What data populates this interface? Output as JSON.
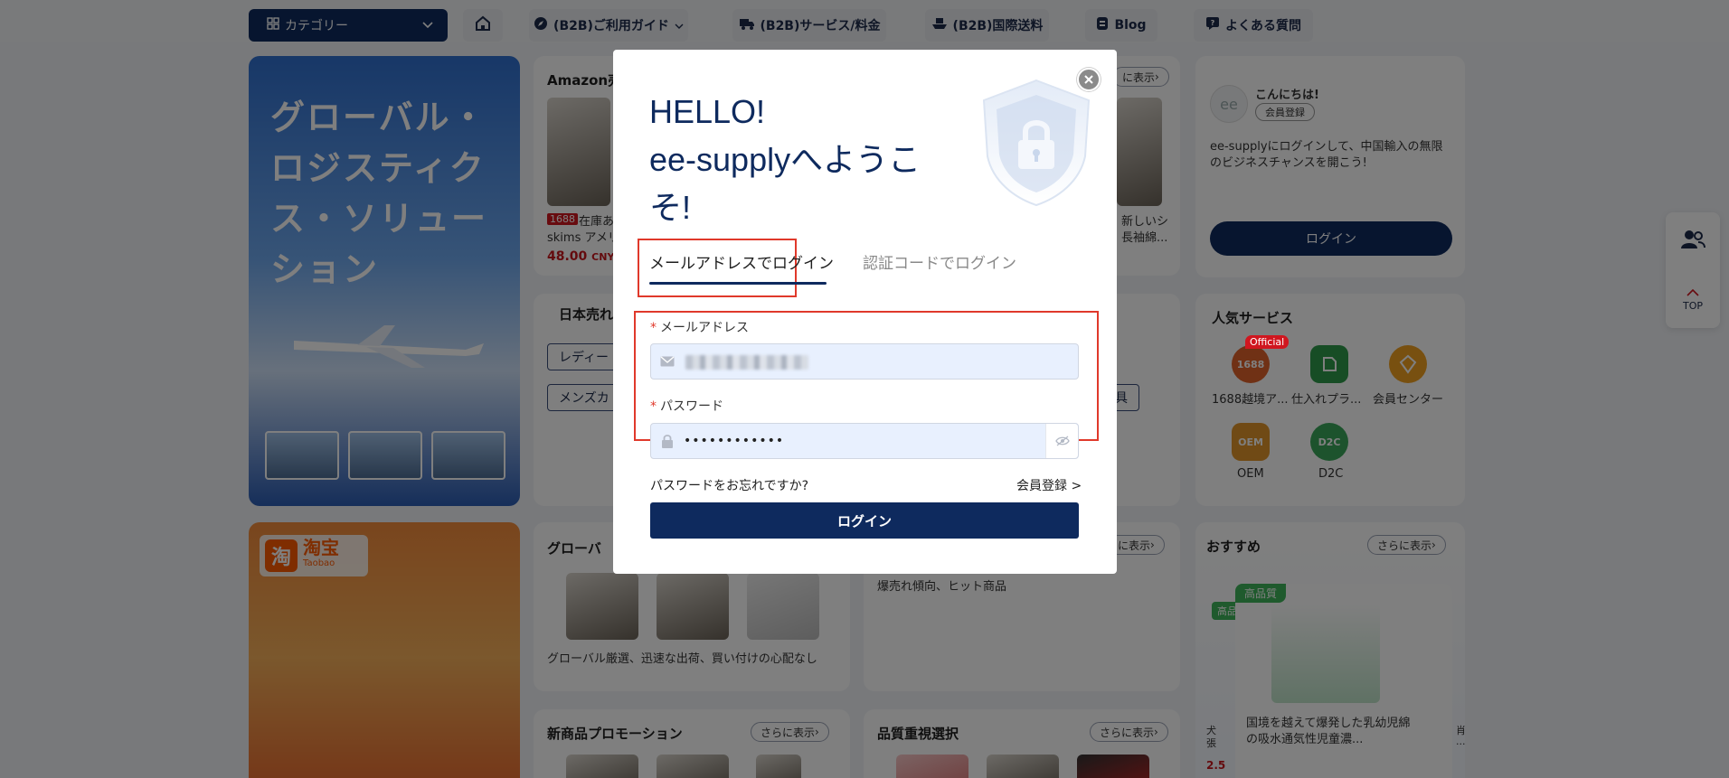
{
  "nav": {
    "category": "カテゴリー",
    "guide": "(B2B)ご利用ガイド",
    "service": "(B2B)サービス/料金",
    "shipping": "(B2B)国際送料",
    "blog": "Blog",
    "faq": "よくある質問"
  },
  "banner_logistics": {
    "title": "グローバル・ロジスティクス・ソリューション"
  },
  "banner_taobao": {
    "icon_char": "淘",
    "name": "淘宝",
    "sub": "Taobao"
  },
  "amazon_section": {
    "title": "Amazon売",
    "more": "に表示",
    "product1": {
      "tag": "1688",
      "name": "在庫あ",
      "line2": "skims アメリ",
      "price": "48.00",
      "currency": "CNY"
    },
    "product2": {
      "name": "新しいシ",
      "line2": "長袖綿..."
    }
  },
  "japan_section": {
    "title": "日本売れ",
    "chip1": "レディー",
    "chip2": "メンズカ",
    "chip3": "具"
  },
  "global_section": {
    "title": "グローバ",
    "more": "に表示",
    "desc": "グローバル厳選、迅速な出荷、買い付けの心配なし"
  },
  "trend_section": {
    "desc": "爆売れ傾向、ヒット商品"
  },
  "new_promo": {
    "title": "新商品プロモーション",
    "more": "さらに表示"
  },
  "quality_select": {
    "title": "品質重視選択",
    "more": "さらに表示"
  },
  "welcome_card": {
    "greeting": "こんにちは!",
    "member_badge": "会員登録",
    "message": "ee-supplyにログインして、中国輸入の無限のビジネスチャンスを開こう!",
    "login": "ログイン"
  },
  "popular_services": {
    "title": "人気サービス",
    "official": "Official",
    "items": [
      {
        "label": "1688越境ア...",
        "icon_text": "1688",
        "color": "#e0622a"
      },
      {
        "label": "仕入れプラ...",
        "icon_text": "",
        "color": "#2e9a4a"
      },
      {
        "label": "会員センター",
        "icon_text": "",
        "color": "#f0a020"
      },
      {
        "label": "OEM",
        "icon_text": "OEM",
        "color": "#e0952a"
      },
      {
        "label": "D2C",
        "icon_text": "D2C",
        "color": "#3aa65a"
      }
    ]
  },
  "recommend": {
    "title": "おすすめ",
    "more": "さらに表示",
    "badge": "高品質",
    "badge_back": "高品",
    "product_text": "国境を越えて爆発した乳幼児綿の吸水通気性児童濃...",
    "side_left1": "犬",
    "side_left2": "張",
    "side_left_price": "2.5",
    "side_right1": "肖",
    "side_right2": "..."
  },
  "side_float": {
    "top": "TOP"
  },
  "login_modal": {
    "hello": "HELLO!",
    "welcome": "ee-supplyへようこそ!",
    "tab_email": "メールアドレスでログイン",
    "tab_code": "認証コードでログイン",
    "email_label": "メールアドレス",
    "email_value": "",
    "password_label": "パスワード",
    "password_value": "••••••••••••",
    "required_mark": "*",
    "forgot": "パスワードをお忘れですか?",
    "register": "会員登録 >",
    "submit": "ログイン"
  },
  "colors": {
    "brand_navy": "#0e2a5e",
    "highlight_red": "#e0392b",
    "input_bg": "#e8f0fe"
  }
}
